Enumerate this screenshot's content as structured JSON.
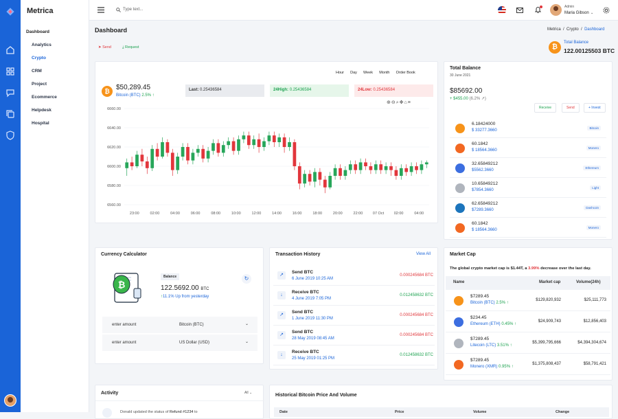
{
  "app": {
    "brand": "Metrica"
  },
  "topbar": {
    "search_placeholder": "Type text...",
    "user_role": "Admin",
    "user_name": "Maria Gibson"
  },
  "sidebar": {
    "section": "Dashboard",
    "items": [
      {
        "label": "Analytics"
      },
      {
        "label": "Crypto"
      },
      {
        "label": "CRM"
      },
      {
        "label": "Project"
      },
      {
        "label": "Ecommerce"
      },
      {
        "label": "Helpdesk"
      },
      {
        "label": "Hospital"
      }
    ]
  },
  "page": {
    "title": "Dashboard",
    "breadcrumb": [
      "Metrica",
      "/",
      "Crypto",
      "/",
      "Dashboard"
    ],
    "send": "Send",
    "request": "Request",
    "total_balance_label": "Total Balance",
    "total_balance": "122.00125503 BTC"
  },
  "price": {
    "value": "$50,289.45",
    "coin": "Bitcoin (BTC)",
    "change": "2.5%",
    "last_label": "Last:",
    "last": "0.25436584",
    "high_label": "24High:",
    "high": "0.25436584",
    "low_label": "24Low:",
    "low": "0.25436584",
    "ranges": [
      "Hour",
      "Day",
      "Week",
      "Month",
      "Order Book"
    ]
  },
  "chart_data": {
    "type": "candlestick",
    "y_ticks": [
      "6660.00",
      "6640.00",
      "6620.00",
      "6600.00",
      "6580.00",
      "6560.00"
    ],
    "x_ticks": [
      "23:00",
      "02:00",
      "04:00",
      "06:00",
      "08:00",
      "10:00",
      "12:00",
      "14:00",
      "16:00",
      "18:00",
      "20:00",
      "22:00",
      "07 Oct",
      "02:00",
      "04:00"
    ],
    "ylim": [
      6560,
      6660
    ],
    "candles": [
      [
        6598,
        6604,
        6590,
        6608
      ],
      [
        6604,
        6600,
        6596,
        6610
      ],
      [
        6600,
        6612,
        6598,
        6616
      ],
      [
        6612,
        6605,
        6600,
        6618
      ],
      [
        6605,
        6598,
        6592,
        6610
      ],
      [
        6598,
        6618,
        6595,
        6622
      ],
      [
        6618,
        6610,
        6606,
        6624
      ],
      [
        6610,
        6625,
        6608,
        6630
      ],
      [
        6625,
        6614,
        6610,
        6628
      ],
      [
        6614,
        6596,
        6590,
        6618
      ],
      [
        6596,
        6610,
        6592,
        6614
      ],
      [
        6610,
        6620,
        6606,
        6624
      ],
      [
        6620,
        6606,
        6602,
        6624
      ],
      [
        6606,
        6614,
        6602,
        6618
      ],
      [
        6614,
        6618,
        6610,
        6622
      ],
      [
        6618,
        6608,
        6604,
        6622
      ],
      [
        6608,
        6616,
        6604,
        6620
      ],
      [
        6616,
        6624,
        6612,
        6628
      ],
      [
        6624,
        6614,
        6610,
        6628
      ],
      [
        6614,
        6622,
        6610,
        6626
      ],
      [
        6622,
        6626,
        6618,
        6630
      ],
      [
        6626,
        6616,
        6612,
        6630
      ],
      [
        6616,
        6628,
        6612,
        6632
      ],
      [
        6628,
        6632,
        6624,
        6636
      ],
      [
        6632,
        6622,
        6618,
        6636
      ],
      [
        6622,
        6628,
        6618,
        6632
      ],
      [
        6628,
        6620,
        6614,
        6634
      ],
      [
        6620,
        6626,
        6616,
        6630
      ],
      [
        6626,
        6632,
        6622,
        6636
      ],
      [
        6632,
        6625,
        6620,
        6636
      ],
      [
        6625,
        6630,
        6620,
        6634
      ],
      [
        6630,
        6620,
        6614,
        6634
      ],
      [
        6620,
        6625,
        6616,
        6630
      ],
      [
        6625,
        6600,
        6596,
        6628
      ],
      [
        6600,
        6582,
        6576,
        6604
      ],
      [
        6582,
        6592,
        6578,
        6596
      ],
      [
        6592,
        6584,
        6580,
        6596
      ],
      [
        6584,
        6594,
        6578,
        6598
      ],
      [
        6594,
        6586,
        6580,
        6598
      ],
      [
        6586,
        6578,
        6572,
        6590
      ],
      [
        6578,
        6590,
        6576,
        6594
      ],
      [
        6590,
        6598,
        6586,
        6602
      ],
      [
        6598,
        6590,
        6586,
        6602
      ],
      [
        6590,
        6596,
        6586,
        6600
      ],
      [
        6596,
        6602,
        6592,
        6606
      ],
      [
        6602,
        6596,
        6592,
        6606
      ],
      [
        6596,
        6604,
        6592,
        6608
      ],
      [
        6604,
        6600,
        6596,
        6608
      ],
      [
        6600,
        6596,
        6592,
        6604
      ],
      [
        6596,
        6602,
        6592,
        6606
      ],
      [
        6602,
        6596,
        6592,
        6606
      ],
      [
        6596,
        6600,
        6592,
        6604
      ],
      [
        6600,
        6596,
        6590,
        6604
      ],
      [
        6596,
        6590,
        6586,
        6600
      ],
      [
        6590,
        6598,
        6586,
        6602
      ],
      [
        6598,
        6594,
        6590,
        6602
      ],
      [
        6594,
        6600,
        6590,
        6604
      ],
      [
        6600,
        6596,
        6592,
        6604
      ],
      [
        6596,
        6602,
        6592,
        6606
      ],
      [
        6602,
        6604,
        6598,
        6606
      ]
    ]
  },
  "total_balance": {
    "title": "Total Balance",
    "date": "30 June 2021",
    "amount": "$85692.00",
    "change": "+ $455.00",
    "change_pct": "(6.2% ↗)",
    "actions": [
      "Receive",
      "Send",
      "+ Invest"
    ],
    "assets": [
      {
        "amount": "6.18424000",
        "value": "$ 33277.3660",
        "tag": "Bitcoin",
        "color": "#f7931a"
      },
      {
        "amount": "60.1842",
        "value": "$ 18564.3660",
        "tag": "Monero",
        "color": "#f26822"
      },
      {
        "amount": "32.65849212",
        "value": "$5562.3660",
        "tag": "Ethereum",
        "color": "#3c6ee0"
      },
      {
        "amount": "10.65849212",
        "value": "$7854.3660",
        "tag": "Light",
        "color": "#b0b5bd"
      },
      {
        "amount": "62.65849212",
        "value": "$7289.3660",
        "tag": "Dashcoin",
        "color": "#1c75bc"
      },
      {
        "amount": "60.1842",
        "value": "$ 18564.3660",
        "tag": "Monero",
        "color": "#f26822"
      }
    ]
  },
  "calculator": {
    "title": "Currency Calculator",
    "badge": "Balance",
    "amount": "122.5692.00",
    "unit": "BTC",
    "change": "11.1%",
    "change_text": "Up from yesterday",
    "rows": [
      {
        "label": "enter amount",
        "value": "Bitcoin (BTC)"
      },
      {
        "label": "enter amount",
        "value": "US Dollar (USD)"
      }
    ]
  },
  "transactions": {
    "title": "Transaction History",
    "view_all": "View All",
    "items": [
      {
        "type": "Send BTC",
        "date": "6 June 2019 10:25 AM",
        "amount": "0.000245684 BTC",
        "dir": "send"
      },
      {
        "type": "Receive BTC",
        "date": "4 June 2019 7:05 PM",
        "amount": "0.012458632 BTC",
        "dir": "receive"
      },
      {
        "type": "Send BTC",
        "date": "1 June 2019 11:30 PM",
        "amount": "0.000245684 BTC",
        "dir": "send"
      },
      {
        "type": "Send BTC",
        "date": "28 May 2019 08:45 AM",
        "amount": "0.000245684 BTC",
        "dir": "send"
      },
      {
        "type": "Receive BTC",
        "date": "25 May 2019 01:25 PM",
        "amount": "0.012458632 BTC",
        "dir": "receive"
      }
    ]
  },
  "market": {
    "title": "Market Cap",
    "summary_pre": "The global crypto market cap is $1.44T, a ",
    "summary_pct": "3.99%",
    "summary_post": " decrease over the last day.",
    "headers": [
      "Name",
      "Market cap",
      "Volume(24h)"
    ],
    "rows": [
      {
        "price": "$7289.45",
        "name": "Bitcoin (BTC)",
        "chg": "2.5%",
        "cap": "$129,820,932",
        "vol": "$25,111,773",
        "color": "#f7931a"
      },
      {
        "price": "$234.45",
        "name": "Ethereum (ETH)",
        "chg": "0.45%",
        "cap": "$24,909,743",
        "vol": "$12,856,403",
        "color": "#3c6ee0"
      },
      {
        "price": "$7289.45",
        "name": "Litecoin (LTC)",
        "chg": "3.51%",
        "cap": "$5,399,795,666",
        "vol": "$4,394,304,674",
        "color": "#b0b5bd"
      },
      {
        "price": "$7289.45",
        "name": "Monero (XMR)",
        "chg": "0.95%",
        "cap": "$1,375,808,437",
        "vol": "$58,791,421",
        "color": "#f26822"
      }
    ]
  },
  "activity": {
    "title": "Activity",
    "filter": "All",
    "first_user": "Donald",
    "first_text": "updated the status of",
    "first_link": "Refund #1234",
    "first_tail": "to"
  },
  "history": {
    "title": "Historical Bitcoin Price And Volume",
    "headers": [
      "Date",
      "Price",
      "Volume",
      "Change"
    ]
  }
}
